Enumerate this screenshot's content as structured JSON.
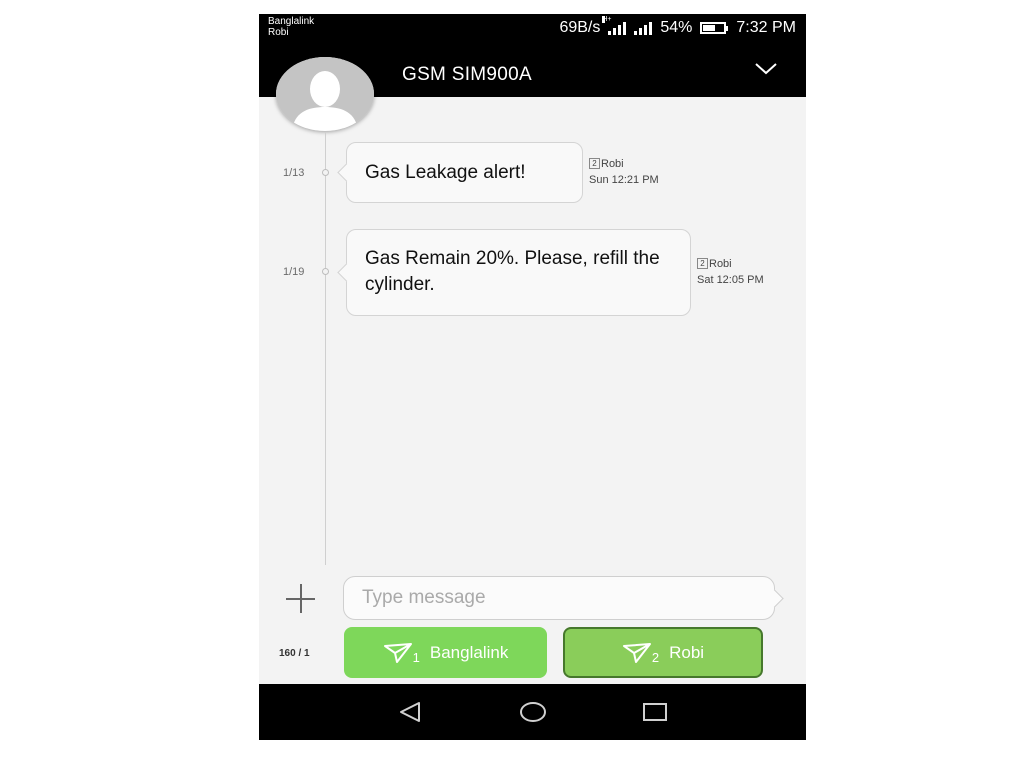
{
  "status_bar": {
    "carrier_1": "Banglalink",
    "carrier_2": "Robi",
    "network_speed": "69B/s",
    "network_type": "H+",
    "battery_percent": "54%",
    "battery_level": 0.54,
    "time": "7:32 PM"
  },
  "header": {
    "contact_name": "GSM SIM900A",
    "expand_icon": "chevron-down-icon",
    "avatar_icon": "person-silhouette-icon"
  },
  "messages": [
    {
      "counter": "1/13",
      "text": "Gas Leakage alert!",
      "sim_slot": "2",
      "sim_name": "Robi",
      "timestamp": "Sun 12:21 PM"
    },
    {
      "counter": "1/19",
      "text": "Gas Remain 20%. Please, refill the cylinder.",
      "sim_slot": "2",
      "sim_name": "Robi",
      "timestamp": "Sat 12:05 PM"
    }
  ],
  "composer": {
    "attach_icon": "plus-icon",
    "placeholder": "Type message",
    "value": "",
    "char_count": "160 / 1",
    "send_sim1": {
      "slot": "1",
      "label": "Banglalink",
      "icon": "send-icon"
    },
    "send_sim2": {
      "slot": "2",
      "label": "Robi",
      "icon": "send-icon"
    }
  },
  "nav_bar": {
    "back_icon": "back-triangle-icon",
    "home_icon": "home-circle-icon",
    "recents_icon": "recents-square-icon"
  },
  "colors": {
    "status_bar_bg": "#000000",
    "conversation_bg": "#f3f3f3",
    "send_sim1_bg": "#7ed75a",
    "send_sim2_bg": "#8acd5a",
    "send_sim2_border": "#46782c",
    "bubble_bg": "#f9f9f9"
  }
}
